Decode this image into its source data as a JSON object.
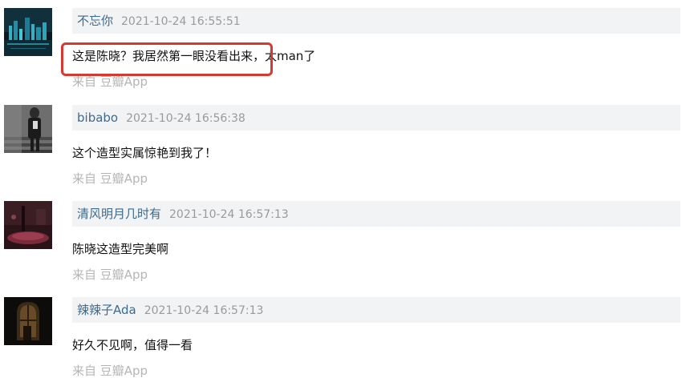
{
  "comments": [
    {
      "author": "不忘你",
      "timestamp": "2021-10-24 16:55:51",
      "text": "这是陈晓？我居然第一眼没看出来，太man了",
      "source": "来自 豆瓣App",
      "avatar_icon": "city-night-avatar",
      "highlighted": true
    },
    {
      "author": "bibabo",
      "timestamp": "2021-10-24 16:56:38",
      "text": "这个造型实属惊艳到我了！",
      "source": "来自 豆瓣App",
      "avatar_icon": "person-stairs-avatar",
      "highlighted": false
    },
    {
      "author": "清风明月几时有",
      "timestamp": "2021-10-24 16:57:13",
      "text": "陈晓这造型完美啊",
      "source": "来自 豆瓣App",
      "avatar_icon": "dark-red-scene-avatar",
      "highlighted": false
    },
    {
      "author": "辣辣子Ada",
      "timestamp": "2021-10-24 16:57:13",
      "text": "好久不见啊，值得一看",
      "source": "来自 豆瓣App",
      "avatar_icon": "dark-window-avatar",
      "highlighted": false
    }
  ],
  "colors": {
    "author": "#3e6a8c",
    "timestamp": "#9a9a9a",
    "header_bg": "#f1f3f5",
    "source": "#b5b5b5",
    "highlight": "#d63a2f"
  }
}
